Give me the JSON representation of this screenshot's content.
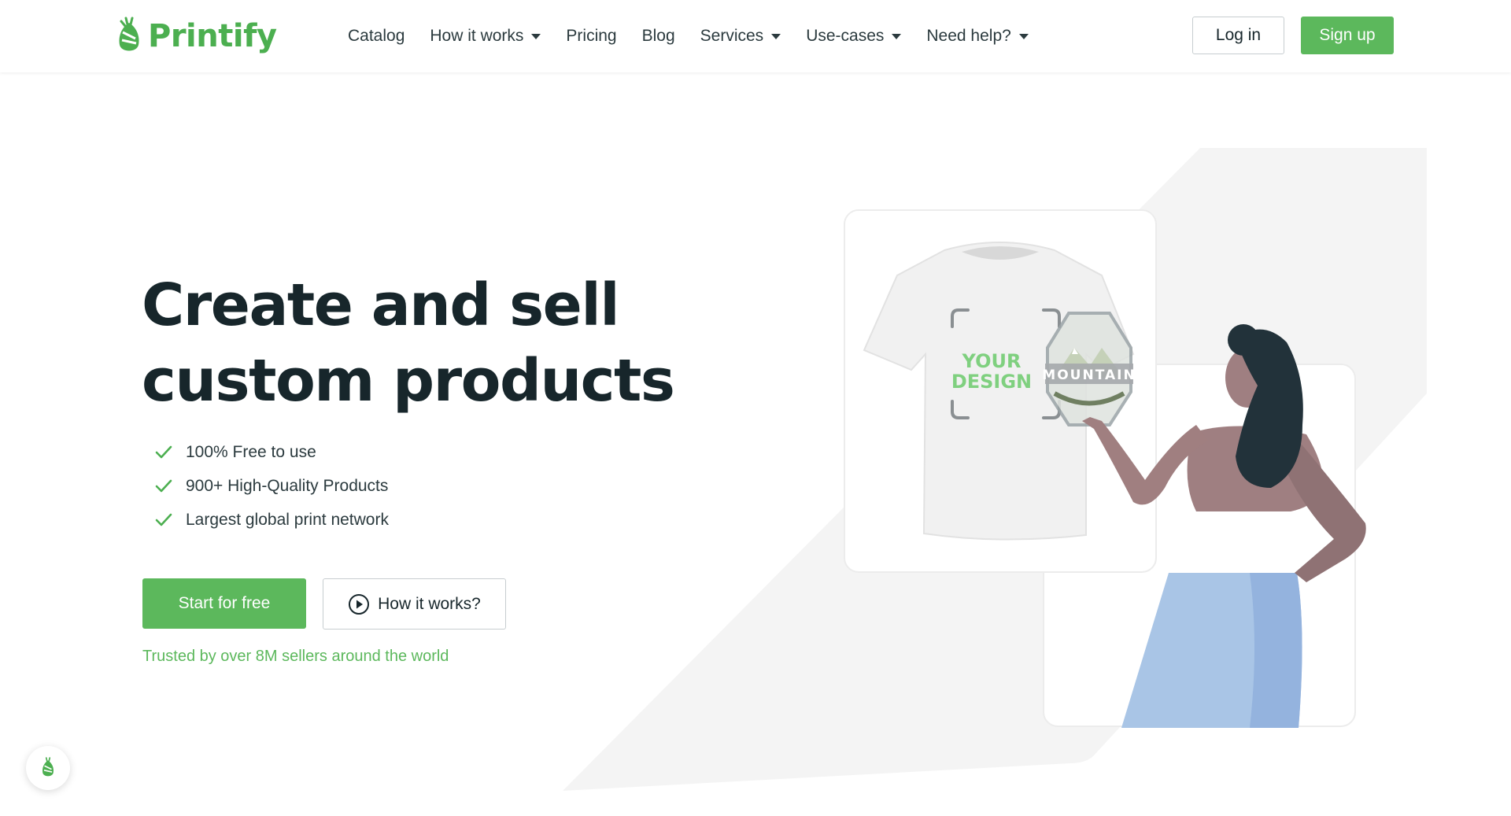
{
  "brand": {
    "name": "Printify",
    "accent": "#5cb85c",
    "dark": "#17262b"
  },
  "nav": {
    "items": [
      {
        "label": "Catalog",
        "dropdown": false
      },
      {
        "label": "How it works",
        "dropdown": true
      },
      {
        "label": "Pricing",
        "dropdown": false
      },
      {
        "label": "Blog",
        "dropdown": false
      },
      {
        "label": "Services",
        "dropdown": true
      },
      {
        "label": "Use-cases",
        "dropdown": true
      },
      {
        "label": "Need help?",
        "dropdown": true
      }
    ],
    "login": "Log in",
    "signup": "Sign up"
  },
  "hero": {
    "headline_line1": "Create and sell",
    "headline_line2": "custom products",
    "features": [
      "100% Free to use",
      "900+ High-Quality Products",
      "Largest global print network"
    ],
    "start_button": "Start for free",
    "how_button": "How it works?",
    "trusted": "Trusted by over 8M sellers around the world"
  },
  "illustration": {
    "design_label_1": "YOUR",
    "design_label_2": "DESIGN",
    "badge_text": "MOUNTAIN"
  },
  "icons": [
    "printify-logo-icon",
    "chevron-down-icon",
    "check-icon",
    "play-circle-icon",
    "chat-icon"
  ]
}
